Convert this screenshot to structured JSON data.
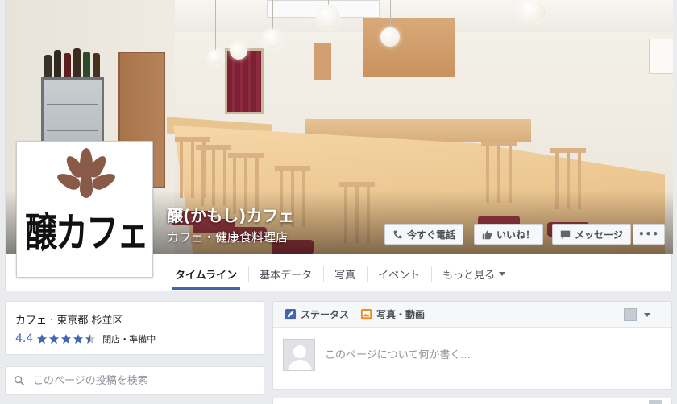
{
  "page": {
    "name": "醸(かもし)カフェ",
    "category": "カフェ・健康食料理店",
    "logo_text": "醸カフェ"
  },
  "cover_buttons": {
    "call": "今すぐ電話",
    "like": "いいね！",
    "message": "メッセージ",
    "more": "•••"
  },
  "tabs": [
    {
      "label": "タイムライン",
      "active": true
    },
    {
      "label": "基本データ"
    },
    {
      "label": "写真"
    },
    {
      "label": "イベント"
    },
    {
      "label": "もっと見る"
    }
  ],
  "about": {
    "location": "カフェ · 東京都 杉並区",
    "rating": "4.4",
    "stars": 4.4,
    "status": "閉店・準備中"
  },
  "search": {
    "placeholder": "このページの投稿を検索"
  },
  "composer": {
    "status_tab": "ステータス",
    "photo_tab": "写真・動画",
    "placeholder": "このページについて何か書く..."
  },
  "colors": {
    "accent": "#4267b2",
    "star": "#4267b2",
    "background": "#e9ebee"
  },
  "icons": [
    "phone-icon",
    "thumbs-up-icon",
    "message-icon",
    "search-icon",
    "pencil-icon",
    "photo-icon"
  ]
}
